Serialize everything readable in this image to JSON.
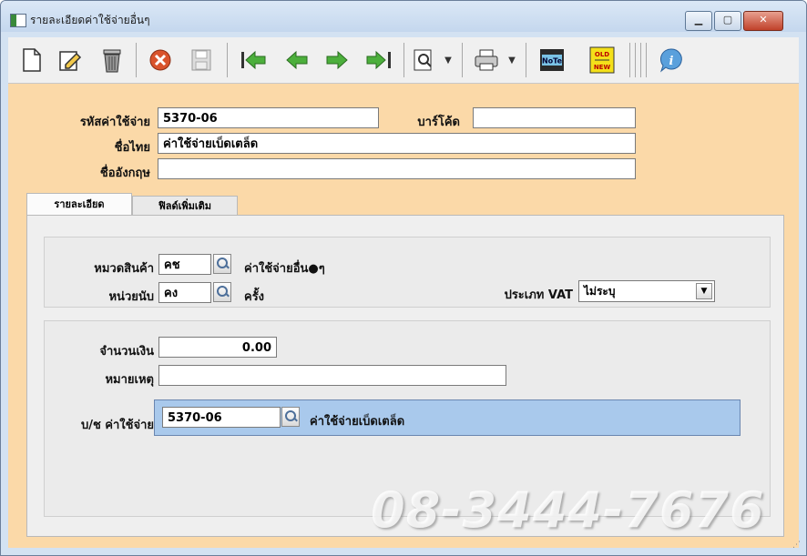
{
  "window": {
    "title": "รายละเอียดค่าใช้จ่ายอื่นๆ"
  },
  "colors": {
    "form_bg": "#fbd9a8",
    "highlight_row": "#a9c9ec",
    "close_button": "#c0412a"
  },
  "toolbar": {
    "buttons": [
      {
        "name": "new-document-icon",
        "glyph": "🗋"
      },
      {
        "name": "edit-icon",
        "glyph": "✎"
      },
      {
        "name": "trash-icon",
        "glyph": "🗑"
      },
      {
        "name": "cancel-icon",
        "glyph": "✖"
      },
      {
        "name": "save-icon",
        "glyph": "💾"
      },
      {
        "name": "first-record-icon",
        "glyph": "⏮"
      },
      {
        "name": "previous-record-icon",
        "glyph": "⇦"
      },
      {
        "name": "next-record-icon",
        "glyph": "⇨"
      },
      {
        "name": "last-record-icon",
        "glyph": "⏭"
      },
      {
        "name": "search-document-icon",
        "glyph": "🔍"
      },
      {
        "name": "print-icon",
        "glyph": "🖶"
      },
      {
        "name": "note-icon",
        "glyph": "▣"
      },
      {
        "name": "old-new-icon",
        "glyph": "▤"
      },
      {
        "name": "info-icon",
        "glyph": "ℹ"
      }
    ],
    "note_label": "NoTe",
    "oldnew_label": "OLD NEW"
  },
  "header": {
    "code_label": "รหัสค่าใช้จ่าย",
    "code_value": "5370-06",
    "barcode_label": "บาร์โค้ด",
    "barcode_value": "",
    "thai_name_label": "ชื่อไทย",
    "thai_name_value": "ค่าใช้จ่ายเบ็ดเตล็ด",
    "eng_name_label": "ชื่ออังกฤษ",
    "eng_name_value": ""
  },
  "tabs": [
    {
      "label": "รายละเอียด"
    },
    {
      "label": "ฟิลด์เพิ่มเติม"
    }
  ],
  "details": {
    "category_label": "หมวดสินค้า",
    "category_code": "คช",
    "category_desc": "ค่าใช้จ่ายอื่น●ๆ",
    "unit_label": "หน่วยนับ",
    "unit_code": "คง",
    "unit_desc": "ครั้ง",
    "vat_label": "ประเภท VAT",
    "vat_value": "ไม่ระบุ",
    "amount_label": "จำนวนเงิน",
    "amount_value": "0.00",
    "note_label": "หมายเหตุ",
    "note_value": "",
    "account_label": "บ/ช ค่าใช้จ่าย",
    "account_code": "5370-06",
    "account_desc": "ค่าใช้จ่ายเบ็ดเตล็ด"
  },
  "watermark": "08-3444-7676"
}
